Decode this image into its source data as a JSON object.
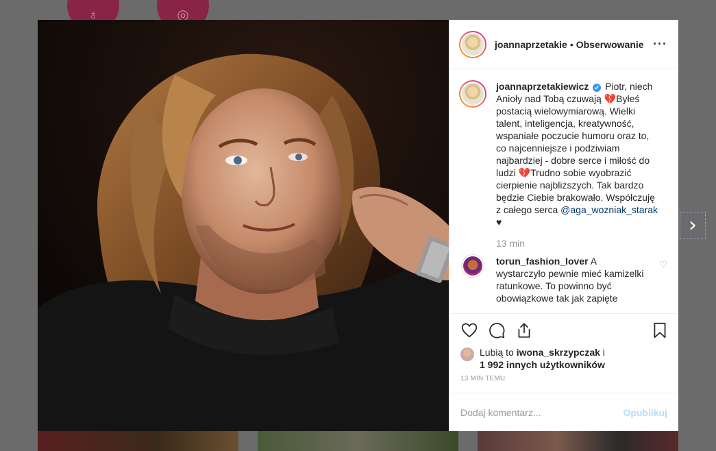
{
  "header": {
    "username": "joannaprzetakie",
    "separator": "•",
    "follow_status": "Obserwowanie",
    "more_icon": "more-horizontal-icon",
    "more_glyph": "···"
  },
  "caption": {
    "username": "joannaprzetakiewicz",
    "verified_glyph": "✔",
    "text_part1": "Piotr, niech Anioły nad Tobą czuwają ",
    "heart1": "💔",
    "text_part2": "Byłeś postacią wielowymiarową. Wielki talent, inteligencja, kreatywność, wspaniałe poczucie humoru oraz to, co najcenniejsze i podziwiam najbardziej - dobre serce i miłość do ludzi ",
    "heart2": "💔",
    "text_part3": "Trudno sobie wyobrazić cierpienie najbliższych. Tak bardzo będzie Ciebie brakowało. Współczuję z całego serca ",
    "mention": "@aga_wozniak_starak",
    "black_heart": "♥",
    "time": "13 min"
  },
  "comment": {
    "username": "torun_fashion_lover",
    "text": " A wystarczyło pewnie mieć kamizelki ratunkowe. To powinno być obowiązkowe tak jak zapięte",
    "like_glyph": "♡"
  },
  "likes": {
    "prefix": "Lubią to ",
    "user": "iwona_skrzypczak",
    "joiner": " i",
    "others": "1 992 innych użytkowników"
  },
  "post_time": "13 MIN TEMU",
  "add_comment": {
    "placeholder": "Dodaj komentarz...",
    "publish": "Opublikuj"
  },
  "next_glyph": "›",
  "colors": {
    "verified": "#3897f0",
    "mention": "#003569",
    "publish_disabled": "#b2dffc",
    "heart": "#d0314f"
  }
}
